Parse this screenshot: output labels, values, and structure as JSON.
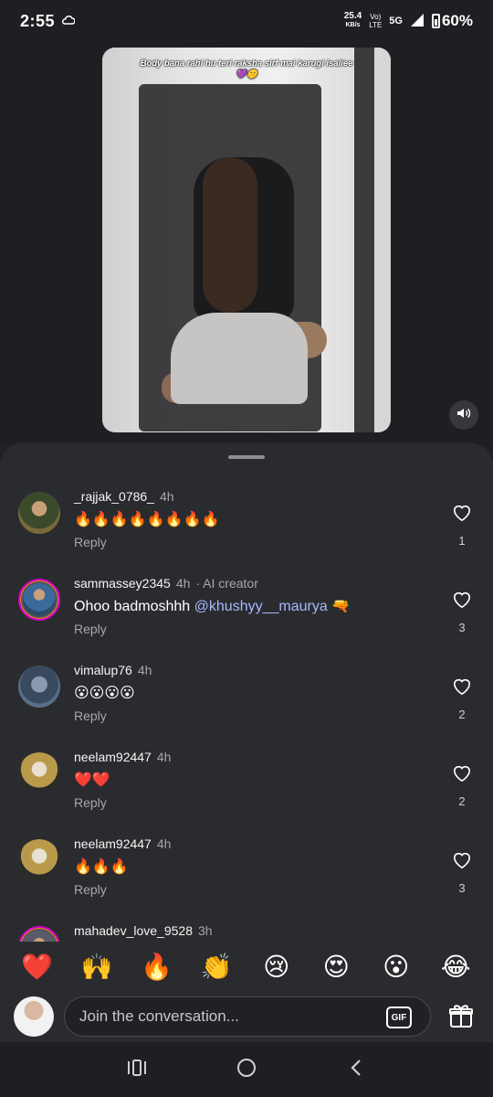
{
  "status_bar": {
    "time": "2:55",
    "speed_value": "25.4",
    "speed_unit": "KB/s",
    "volte": "Vo)",
    "lte": "LTE",
    "network": "5G",
    "battery": "60%"
  },
  "video": {
    "caption": "Body bana rahi hu teri raksha sirf mai karugi isaliee💜🤫"
  },
  "comments": [
    {
      "username": "_rajjak_0786_",
      "time": "4h",
      "tag": "",
      "text": "🔥🔥🔥🔥🔥🔥🔥🔥",
      "mention": "",
      "suffix": "",
      "reply": "Reply",
      "likes": "1",
      "avatar_color": "#6b5a3a"
    },
    {
      "username": "sammassey2345",
      "time": "4h",
      "tag": "· AI creator",
      "text": "Ohoo badmoshhh ",
      "mention": "@khushyy__maurya",
      "suffix": " 🔫",
      "reply": "Reply",
      "likes": "3",
      "avatar_color": "#4a6f8f"
    },
    {
      "username": "vimalup76",
      "time": "4h",
      "tag": "",
      "text": "😮😮😮😮",
      "mention": "",
      "suffix": "",
      "reply": "Reply",
      "likes": "2",
      "avatar_color": "#5b6f8a"
    },
    {
      "username": "neelam92447",
      "time": "4h",
      "tag": "",
      "text": "❤️❤️",
      "mention": "",
      "suffix": "",
      "reply": "Reply",
      "likes": "2",
      "avatar_color": "#8a7a3a"
    },
    {
      "username": "neelam92447",
      "time": "4h",
      "tag": "",
      "text": "🔥🔥🔥",
      "mention": "",
      "suffix": "",
      "reply": "Reply",
      "likes": "3",
      "avatar_color": "#8a7a3a"
    },
    {
      "username": "mahadev_love_9528",
      "time": "3h",
      "tag": "",
      "text": "",
      "mention": "",
      "suffix": "",
      "reply": "",
      "likes": "",
      "avatar_color": "#6a6a7a"
    }
  ],
  "emoji_bar": [
    "❤️",
    "🙌",
    "🔥",
    "👏",
    "😢",
    "😍",
    "😮",
    "😂"
  ],
  "composer": {
    "placeholder": "Join the conversation...",
    "gif_label": "GIF"
  }
}
